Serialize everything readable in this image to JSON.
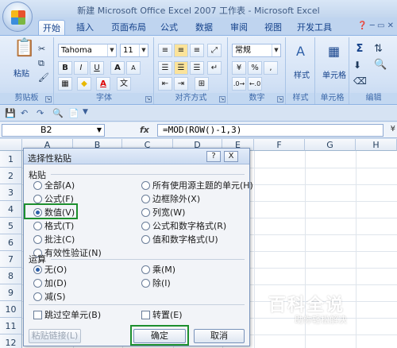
{
  "window": {
    "title": "新建 Microsoft Office Excel 2007 工作表 - Microsoft Excel"
  },
  "tabs": [
    {
      "label": "开始"
    },
    {
      "label": "插入"
    },
    {
      "label": "页面布局"
    },
    {
      "label": "公式"
    },
    {
      "label": "数据"
    },
    {
      "label": "审阅"
    },
    {
      "label": "视图"
    },
    {
      "label": "开发工具"
    }
  ],
  "ribbon": {
    "clipboard": {
      "label": "剪贴板",
      "paste": "粘贴"
    },
    "font": {
      "label": "字体",
      "name": "Tahoma",
      "size": "11",
      "bold": "B",
      "italic": "I",
      "underline": "U",
      "font_color": "A",
      "font_grow": "A",
      "font_shrink": "A"
    },
    "alignment": {
      "label": "对齐方式"
    },
    "number": {
      "label": "数字",
      "format": "常规",
      "percent": "%",
      "comma": ","
    },
    "styles": {
      "label": "样式",
      "btn": "样式"
    },
    "cells": {
      "label": "单元格",
      "btn": "单元格"
    },
    "editing": {
      "label": "编辑",
      "sum": "Σ"
    }
  },
  "formula_bar": {
    "name_box": "B2",
    "fx": "fx",
    "formula": "=MOD(ROW()-1,3)"
  },
  "sheet": {
    "columns": [
      "A",
      "B",
      "C",
      "D",
      "E",
      "F",
      "G",
      "H"
    ],
    "rows": [
      "1",
      "2",
      "3",
      "4",
      "5",
      "6",
      "7",
      "8",
      "9",
      "10",
      "11",
      "12"
    ]
  },
  "dialog": {
    "title": "选择性粘贴",
    "help": "?",
    "close": "X",
    "paste_section": "粘贴",
    "paste_options_left": [
      "全部(A)",
      "公式(F)",
      "数值(V)",
      "格式(T)",
      "批注(C)",
      "有效性验证(N)"
    ],
    "paste_options_right": [
      "所有使用源主题的单元(H)",
      "边框除外(X)",
      "列宽(W)",
      "公式和数字格式(R)",
      "值和数字格式(U)"
    ],
    "operation_section": "运算",
    "operations_left": [
      "无(O)",
      "加(D)",
      "减(S)"
    ],
    "operations_right": [
      "乘(M)",
      "除(I)"
    ],
    "skip_blanks": "跳过空单元(B)",
    "transpose": "转置(E)",
    "paste_link": "粘贴链接(L)",
    "ok": "确定",
    "cancel": "取消"
  },
  "watermark": {
    "title": "百科全说",
    "subtitle": "助你轻松解决"
  }
}
